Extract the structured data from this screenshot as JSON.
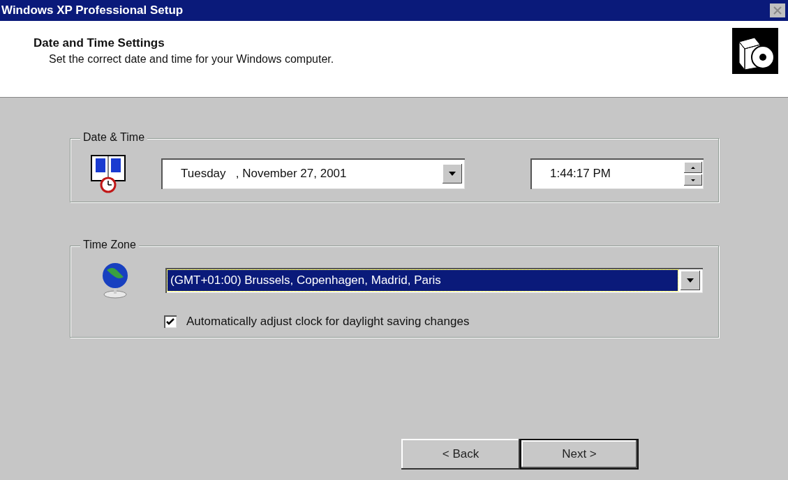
{
  "window": {
    "title": "Windows XP Professional Setup"
  },
  "header": {
    "title": "Date and Time Settings",
    "subtitle": "Set the correct date and time for your Windows computer."
  },
  "date_time": {
    "label": "Date & Time",
    "date": {
      "value": "Tuesday   , November 27, 2001"
    },
    "time": {
      "value": "1:44:17 PM"
    }
  },
  "time_zone": {
    "label": "Time Zone",
    "zone": {
      "value": "(GMT+01:00) Brussels, Copenhagen, Madrid, Paris",
      "selected": true
    },
    "daylight": {
      "label": "Automatically adjust clock for daylight saving changes",
      "checked": true
    }
  },
  "buttons": [
    {
      "label": "< Back",
      "default": false
    },
    {
      "label": "Next >",
      "default": true
    }
  ]
}
